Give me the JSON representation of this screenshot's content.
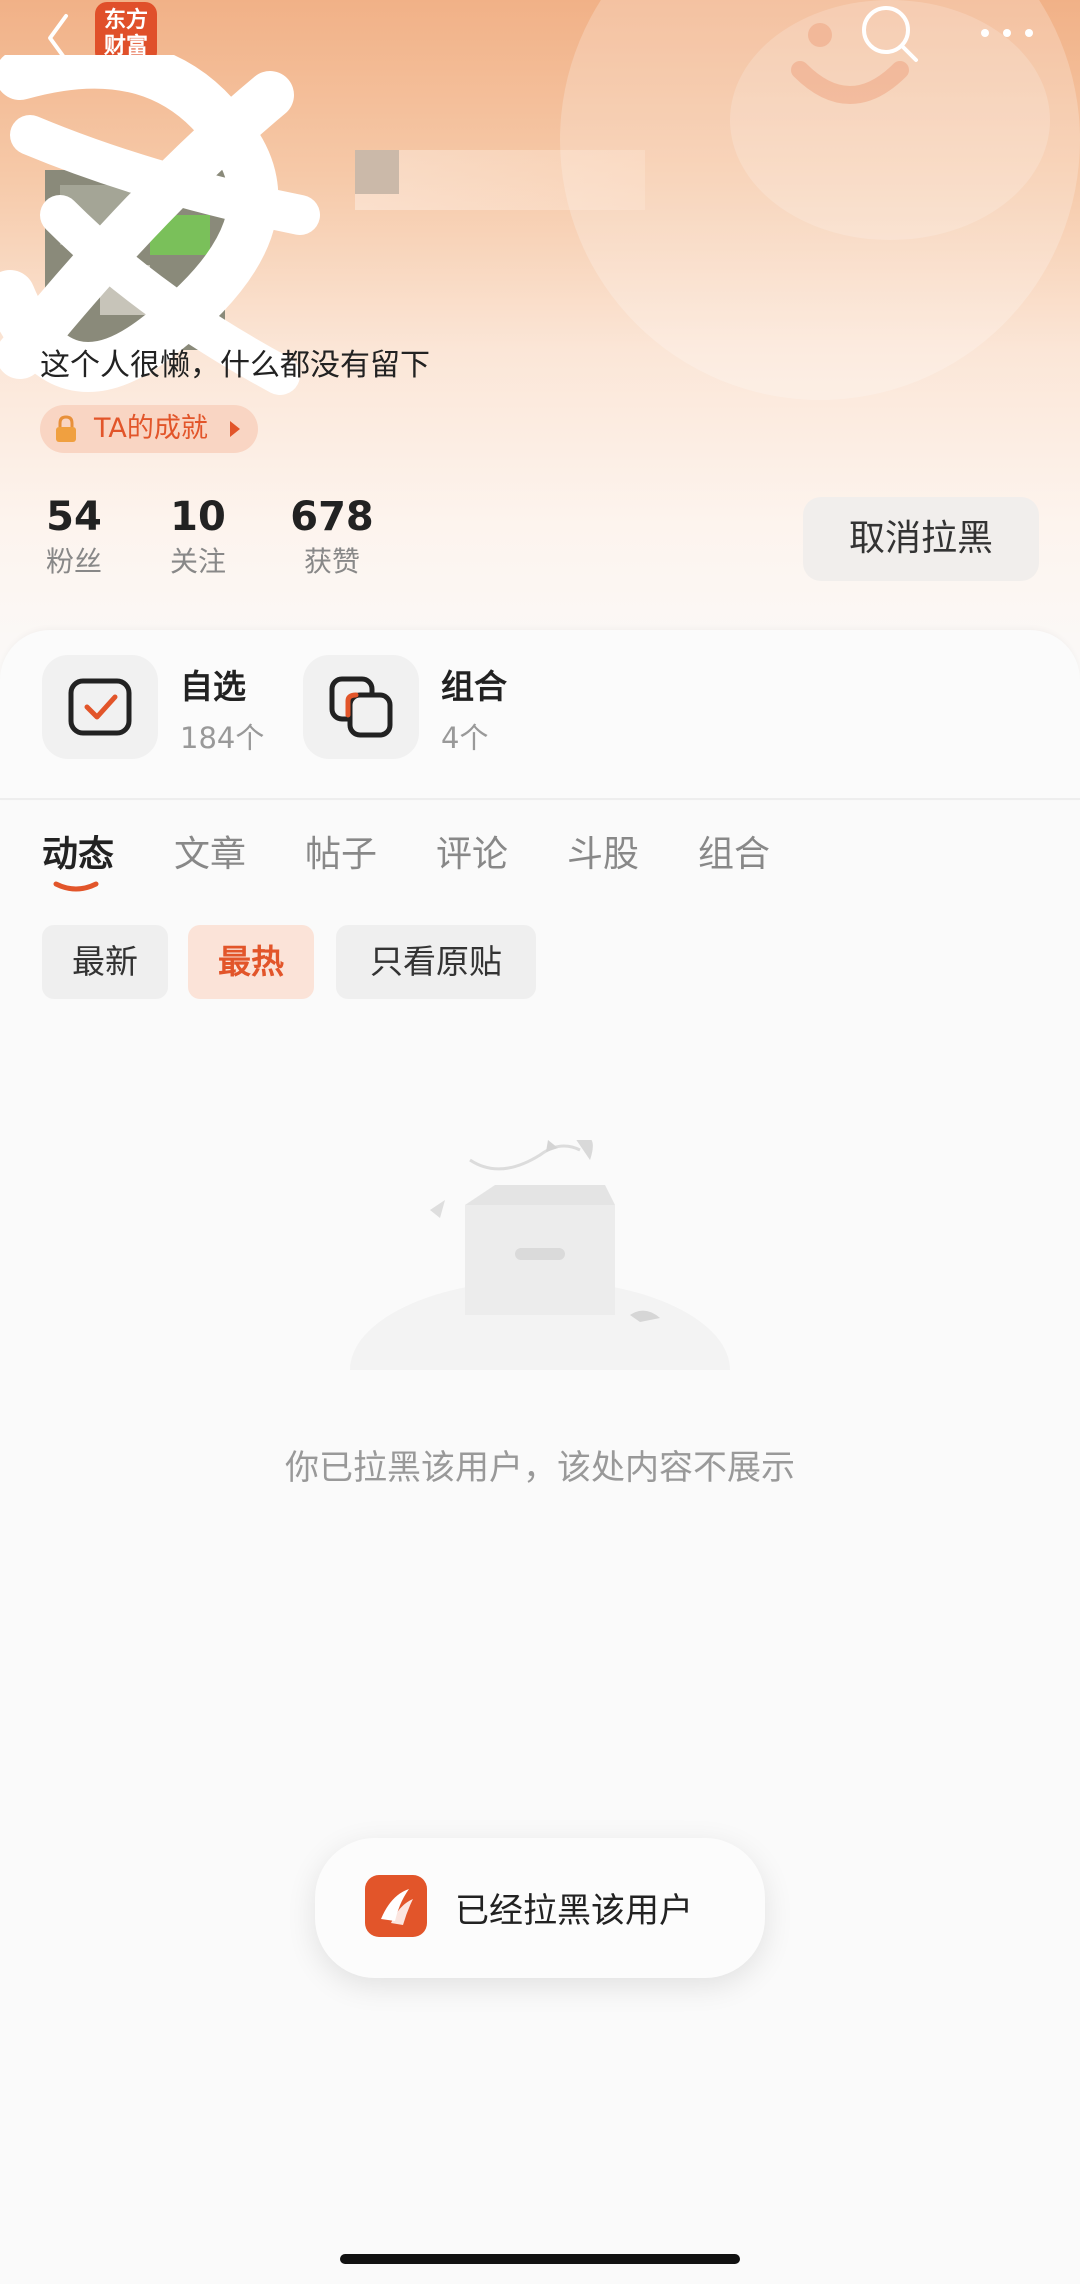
{
  "header": {
    "app_logo_text_line1": "东方",
    "app_logo_text_line2": "财富",
    "brand_color": "#e2552a"
  },
  "profile": {
    "bio": "这个人很懒，什么都没有留下",
    "achievement_badge": "TA的成就"
  },
  "stats": [
    {
      "value": "54",
      "label": "粉丝"
    },
    {
      "value": "10",
      "label": "关注"
    },
    {
      "value": "678",
      "label": "获赞"
    }
  ],
  "actions": {
    "unblock_label": "取消拉黑"
  },
  "portfolio": [
    {
      "title": "自选",
      "count": "184个",
      "icon": "checkbox-icon"
    },
    {
      "title": "组合",
      "count": "4个",
      "icon": "combo-icon"
    }
  ],
  "tabs": [
    "动态",
    "文章",
    "帖子",
    "评论",
    "斗股",
    "组合"
  ],
  "active_tab": "动态",
  "filters": [
    "最新",
    "最热",
    "只看原贴"
  ],
  "active_filter": "最热",
  "empty_state": {
    "message": "你已拉黑该用户，该处内容不展示"
  },
  "toast": {
    "message": "已经拉黑该用户"
  }
}
